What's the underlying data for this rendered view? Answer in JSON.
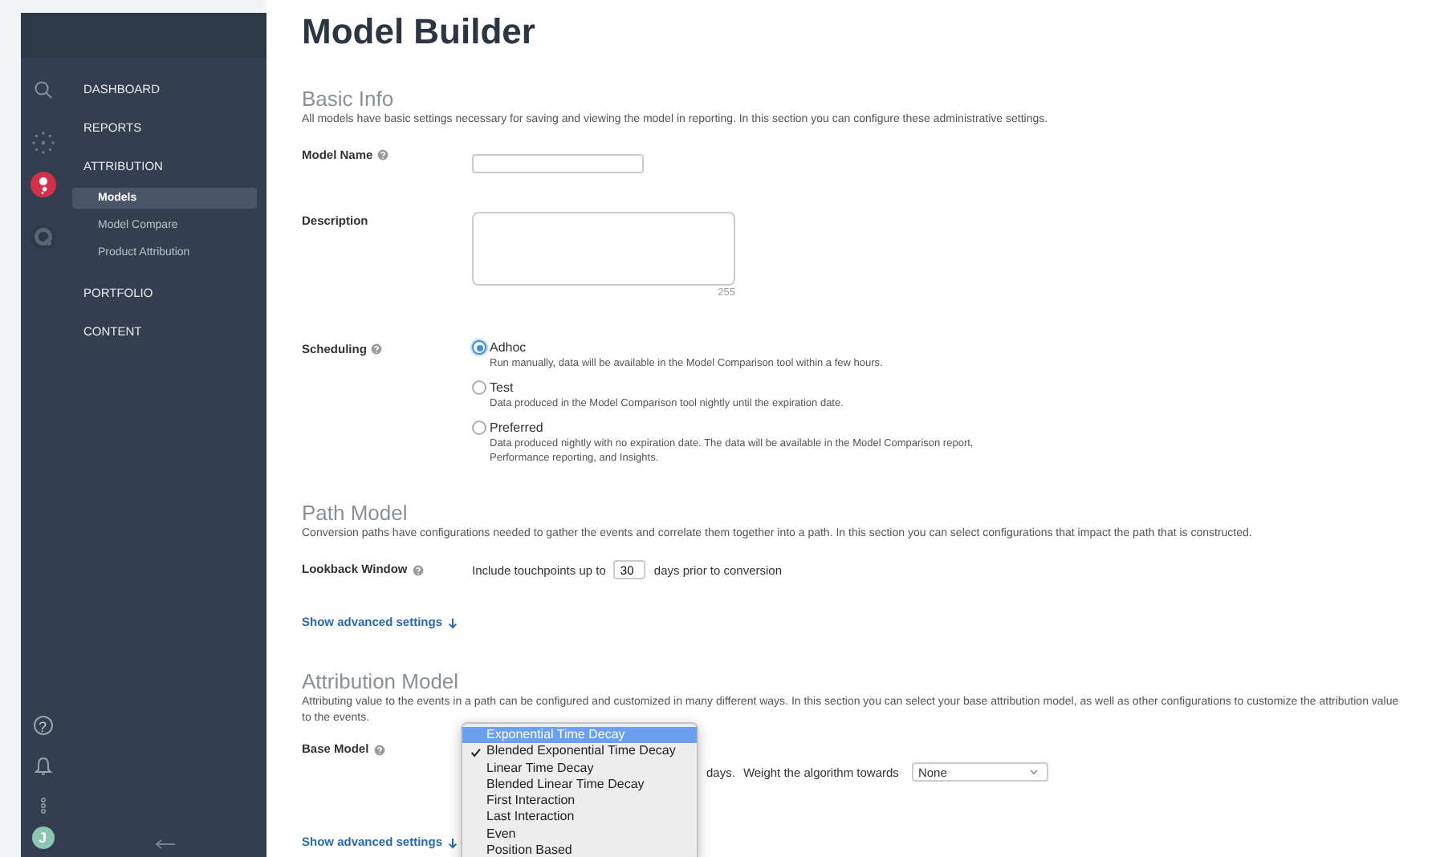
{
  "page_title": "Model Builder",
  "sidebar": {
    "nav": [
      {
        "label": "DASHBOARD"
      },
      {
        "label": "REPORTS"
      },
      {
        "label": "ATTRIBUTION",
        "children": [
          {
            "label": "Models",
            "selected": true
          },
          {
            "label": "Model Compare",
            "selected": false
          },
          {
            "label": "Product Attribution",
            "selected": false
          }
        ]
      },
      {
        "label": "PORTFOLIO"
      },
      {
        "label": "CONTENT"
      }
    ],
    "help_glyph": "?",
    "avatar_initial": "J"
  },
  "sections": [
    {
      "title": "Basic Info",
      "description": "All models have basic settings necessary for saving and viewing the model in reporting. In this section you can configure these administrative settings.",
      "fields": [
        {
          "kind": "text",
          "label": "Model Name",
          "help": true
        },
        {
          "kind": "textarea",
          "label": "Description",
          "counter": "255"
        },
        {
          "kind": "radio",
          "label": "Scheduling",
          "help": true,
          "options": [
            {
              "label": "Adhoc",
              "description": "Run manually, data will be available in the Model Comparison tool within a few hours.",
              "selected": true
            },
            {
              "label": "Test",
              "description": "Data produced in the Model Comparison tool nightly until the expiration date.",
              "selected": false
            },
            {
              "label": "Preferred",
              "description": "Data produced nightly with no expiration date. The data will be available in the Model Comparison report, Performance reporting, and Insights.",
              "selected": false
            }
          ]
        }
      ]
    },
    {
      "title": "Path Model",
      "description": "Conversion paths have configurations needed to gather the events and correlate them together into a path. In this section you can select configurations that impact the path that is constructed.",
      "fields": [
        {
          "kind": "inline",
          "label": "Lookback Window",
          "help": true,
          "before": "Include touchpoints up to",
          "value": "30",
          "after": "days prior to conversion"
        }
      ],
      "advanced_link": "Show advanced settings"
    },
    {
      "title": "Attribution Model",
      "description": "Attributing value to the events in a path can be configured and customized in many different ways. In this section you can select your base attribution model, as well as other configurations to customize the attribution value to the events.",
      "fields": [
        {
          "kind": "base_model",
          "label": "Base Model",
          "help": true,
          "after": "days.",
          "weight_label": "Weight the algorithm towards",
          "weight_value": "None",
          "dropdown": {
            "options": [
              {
                "label": "Exponential Time Decay",
                "highlighted": true,
                "checked": false
              },
              {
                "label": "Blended Exponential Time Decay",
                "highlighted": false,
                "checked": true
              },
              {
                "label": "Linear Time Decay",
                "highlighted": false,
                "checked": false
              },
              {
                "label": "Blended Linear Time Decay",
                "highlighted": false,
                "checked": false
              },
              {
                "label": "First Interaction",
                "highlighted": false,
                "checked": false
              },
              {
                "label": "Last Interaction",
                "highlighted": false,
                "checked": false
              },
              {
                "label": "Even",
                "highlighted": false,
                "checked": false
              },
              {
                "label": "Position Based",
                "highlighted": false,
                "checked": false
              }
            ]
          }
        }
      ],
      "advanced_link": "Show advanced settings"
    }
  ]
}
